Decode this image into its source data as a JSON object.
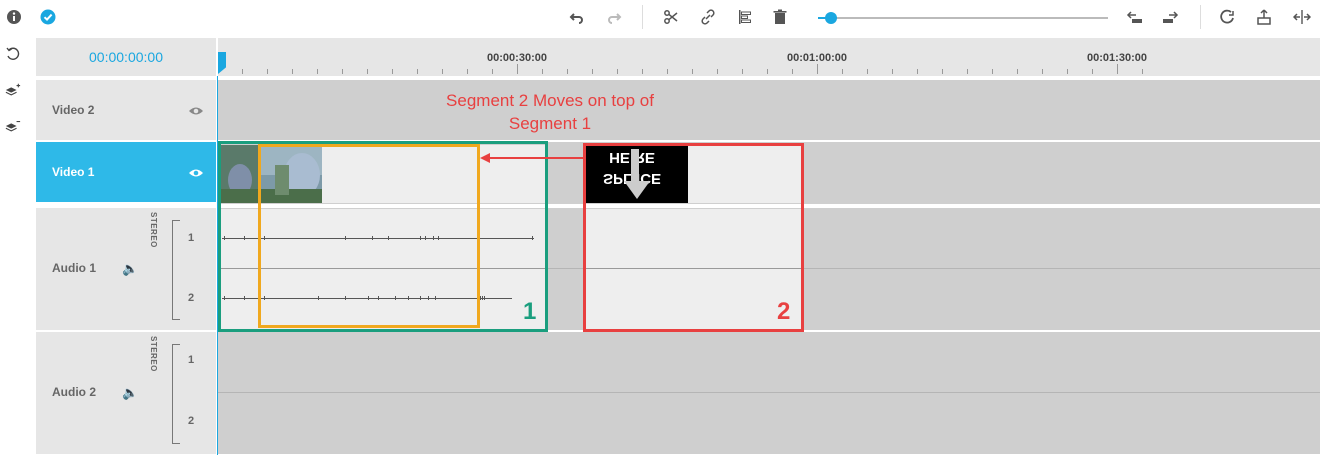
{
  "toolbar": {
    "icons": [
      "info-icon",
      "check-circle-icon",
      "undo-icon",
      "redo-icon",
      "scissors-icon",
      "unlink-icon",
      "align-icon",
      "trash-icon",
      "move-left-icon",
      "move-right-icon",
      "magnet-icon",
      "upload-icon",
      "split-icon"
    ],
    "zoom_level": 0.05,
    "accent_color": "#1aa7e0"
  },
  "sidebar": {
    "icons": [
      "rotate-icon",
      "add-layer-icon",
      "remove-layer-icon"
    ]
  },
  "timeline": {
    "current_time": "00:00:00:00",
    "ruler_labels": [
      "00:00:30:00",
      "00:01:00:00",
      "00:01:30:00"
    ]
  },
  "tracks": {
    "video2": {
      "label": "Video 2"
    },
    "video1": {
      "label": "Video 1"
    },
    "audio1": {
      "label": "Audio 1",
      "stereo": "STEREO",
      "ch1": "1",
      "ch2": "2"
    },
    "audio2": {
      "label": "Audio 2",
      "stereo": "STEREO",
      "ch1": "1",
      "ch2": "2"
    }
  },
  "clips": {
    "splice_title_line1": "HE RE",
    "splice_title_line2": "SPL ICE"
  },
  "annotation": {
    "line1": "Segment 2 Moves on top of",
    "line2": "Segment 1",
    "label_segment1": "1",
    "label_segment2": "2",
    "color_segment1": "#1a9e7e",
    "color_segment2": "#e84040",
    "color_overlay": "#f0a81e"
  }
}
